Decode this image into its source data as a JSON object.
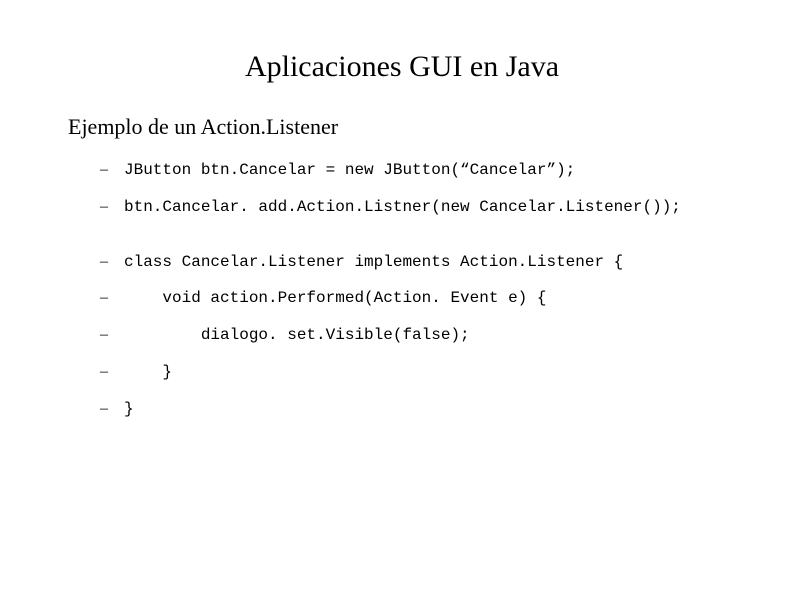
{
  "title": "Aplicaciones GUI en Java",
  "subtitle": "Ejemplo de un Action.Listener",
  "lines": [
    "JButton btn.Cancelar = new JButton(“Cancelar”);",
    "btn.Cancelar. add.Action.Listner(new Cancelar.Listener());",
    "class Cancelar.Listener implements Action.Listener {",
    "    void action.Performed(Action. Event e) {",
    "        dialogo. set.Visible(false);",
    "    }",
    "}"
  ]
}
